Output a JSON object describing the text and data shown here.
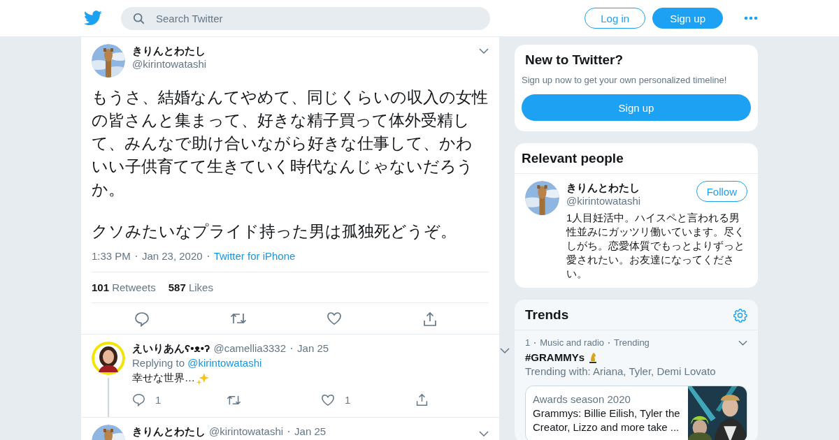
{
  "header": {
    "search_placeholder": "Search Twitter",
    "login": "Log in",
    "signup": "Sign up"
  },
  "tweet": {
    "name": "きりんとわたし",
    "handle": "@kirintowatashi",
    "paragraphs": [
      "もうさ、結婚なんてやめて、同じくらいの収入の女性の皆さんと集まって、好きな精子買って体外受精して、みんなで助け合いながら好きな仕事して、かわいい子供育てて生きていく時代なんじゃないだろうか。",
      "クソみたいなプライド持った男は孤独死どうぞ。"
    ],
    "time": "1:33 PM",
    "date": "Jan 23, 2020",
    "source": "Twitter for iPhone",
    "retweets_count": "101",
    "retweets_label": "Retweets",
    "likes_count": "587",
    "likes_label": "Likes"
  },
  "replies": [
    {
      "kind": "full",
      "name": "えいりあんʕ•ᴥ•ʔ",
      "handle": "@camellia3332",
      "date": "Jan 25",
      "replying_label": "Replying to",
      "replying_to": "@kirintowatashi",
      "text": "幸せな世界…",
      "reply_count": "1",
      "like_count": "1"
    },
    {
      "kind": "cut",
      "name": "きりんとわたし",
      "handle": "@kirintowatashi",
      "date": "Jan 25"
    }
  ],
  "new_to_twitter": {
    "title": "New to Twitter?",
    "subtitle": "Sign up now to get your own personalized timeline!",
    "button": "Sign up"
  },
  "relevant_people": {
    "title": "Relevant people",
    "person": {
      "name": "きりんとわたし",
      "handle": "@kirintowatashi",
      "bio": "1人目妊活中。ハイスペと言われる男性並みにガッツリ働いています。尽くしがち。恋愛体質でもっとよりずっと愛されたい。お友達になってください。",
      "follow": "Follow"
    }
  },
  "trends": {
    "title": "Trends",
    "items": [
      {
        "rank": "1",
        "category": "Music and radio",
        "status": "Trending",
        "name": "#GRAMMYs",
        "context": "Trending with: Ariana, Tyler, Demi Lovato",
        "card": {
          "eyebrow": "Awards season 2020",
          "headline": "Grammys: Billie Eilish, Tyler the Creator, Lizzo and more take ..."
        }
      }
    ]
  }
}
